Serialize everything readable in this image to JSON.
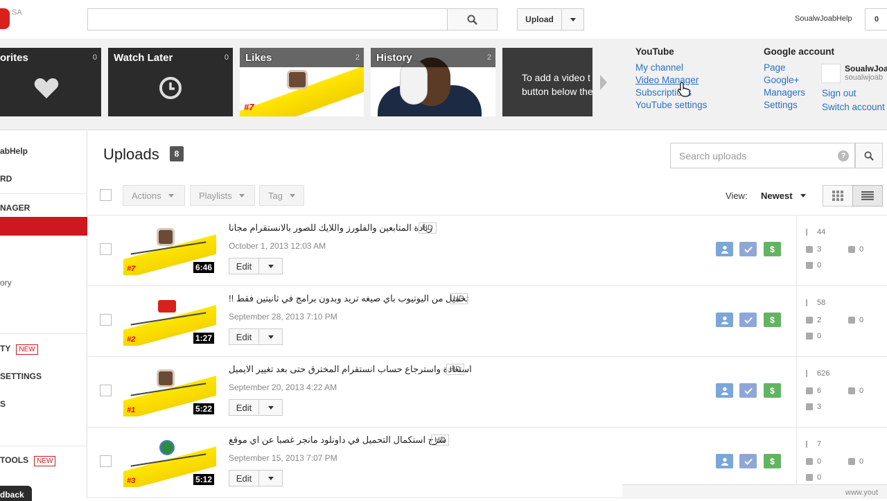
{
  "header": {
    "logo_sub": "SA",
    "search_placeholder": "",
    "upload_label": "Upload",
    "user_name": "SoualwJoabHelp",
    "notifications": "0"
  },
  "guide": {
    "tiles": [
      {
        "title": "orites",
        "count": "0"
      },
      {
        "title": "Watch Later",
        "count": "0"
      },
      {
        "title": "Likes",
        "count": "2"
      },
      {
        "title": "History",
        "count": "2"
      }
    ],
    "promo_line1": "To add a video t",
    "promo_line2": "button below the",
    "youtube_menu": {
      "heading": "YouTube",
      "links": [
        "My channel",
        "Video Manager",
        "Subscriptions",
        "YouTube settings"
      ]
    },
    "google_menu": {
      "heading": "Google account",
      "links": [
        "Page",
        "Google+",
        "Managers",
        "Settings"
      ],
      "account_name": "SoualwJoa",
      "account_sub": "soualwjoab",
      "actions": [
        "Sign out",
        "Switch account"
      ]
    }
  },
  "sidebar": {
    "items": [
      {
        "label": "abHelp"
      },
      {
        "label": "RD"
      },
      {
        "label": "NAGER"
      },
      {
        "label": "ory"
      },
      {
        "label": "TY",
        "badge": "NEW"
      },
      {
        "label": "SETTINGS"
      },
      {
        "label": "S"
      },
      {
        "label": "TOOLS",
        "badge": "NEW"
      }
    ],
    "feedback": "dback"
  },
  "uploads": {
    "title": "Uploads",
    "count": "8",
    "search_placeholder": "Search uploads",
    "help": "?",
    "toolbar": {
      "actions": "Actions",
      "playlists": "Playlists",
      "tag": "Tag"
    },
    "view_label": "View:",
    "view_value": "Newest",
    "videos": [
      {
        "title": "زيادة المتابعين والفلورز واللايك للصور بالانستقرام مجانا",
        "hd": "HD",
        "date": "October 1, 2013 12:03 AM",
        "num": "#7",
        "duration": "6:46",
        "icon": "instagram-icon",
        "views": "44",
        "likes": "3",
        "dislikes": "0",
        "comments": "0"
      },
      {
        "title": "تحميل من اليوتيوب باي صيغه تريد وبدون برامج في ثانيتين فقط !!",
        "hd": "HD",
        "date": "September 28, 2013 7:10 PM",
        "num": "#2",
        "duration": "1:27",
        "icon": "youtube-icon",
        "views": "58",
        "likes": "2",
        "dislikes": "0",
        "comments": "0"
      },
      {
        "title": "استعادة واسترجاع حساب انستقرام المخترق حتى بعد تغيير الايميل",
        "hd": "HD",
        "date": "September 20, 2013 4:22 AM",
        "num": "#1",
        "duration": "5:22",
        "icon": "instagram-icon",
        "views": "626",
        "likes": "6",
        "dislikes": "0",
        "comments": "3"
      },
      {
        "title": "شرح استكمال التحميل في داونلود مانجر غصبا عن اي موقع",
        "hd": "HD",
        "date": "September 15, 2013 7:07 PM",
        "num": "#3",
        "duration": "5:12",
        "icon": "idm-globe-icon",
        "views": "7",
        "likes": "0",
        "dislikes": "0",
        "comments": "0"
      }
    ],
    "monetize_symbol": "$",
    "edit_label": "Edit"
  },
  "footer": {
    "url_fragment": "www.yout"
  },
  "colors": {
    "accent_red": "#cc181e",
    "link_blue": "#2971c4",
    "monetize_green": "#62b463"
  }
}
